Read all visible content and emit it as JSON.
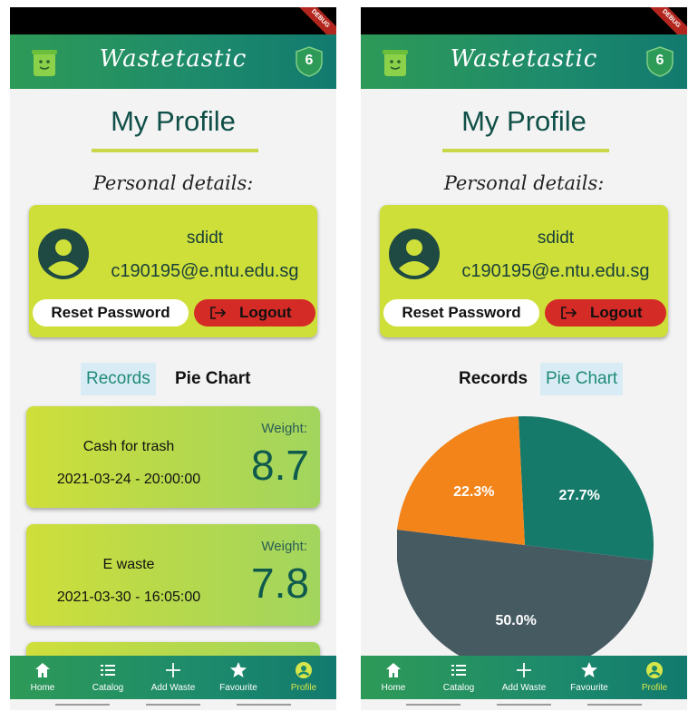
{
  "app": {
    "title": "Wastetastic",
    "badge_count": "6",
    "debug_banner": "DEBUG"
  },
  "profile": {
    "page_title": "My Profile",
    "section_title": "Personal details:",
    "username": "sdidt",
    "email": "c190195@e.ntu.edu.sg",
    "reset_label": "Reset Password",
    "logout_label": "Logout"
  },
  "tabs": {
    "records_label": "Records",
    "pie_label": "Pie Chart"
  },
  "records": [
    {
      "name": "Cash for trash",
      "date": "2021-03-24 - 20:00:00",
      "weight_label": "Weight:",
      "weight": "8.7"
    },
    {
      "name": "E waste",
      "date": "2021-03-30 - 16:05:00",
      "weight_label": "Weight:",
      "weight": "7.8"
    }
  ],
  "nav": [
    {
      "label": "Home",
      "icon": "home-icon"
    },
    {
      "label": "Catalog",
      "icon": "list-icon"
    },
    {
      "label": "Add Waste",
      "icon": "plus-icon"
    },
    {
      "label": "Favourite",
      "icon": "star-icon"
    },
    {
      "label": "Profile",
      "icon": "person-icon"
    }
  ],
  "colors": {
    "accent": "#d6e64a",
    "primary": "#1d8a6c",
    "logout": "#d42b27",
    "card": "#cfdf3a"
  },
  "chart_data": {
    "type": "pie",
    "slices": [
      {
        "label": "27.7%",
        "value": 27.7,
        "color": "#167a6b"
      },
      {
        "label": "50.0%",
        "value": 50.0,
        "color": "#465a62"
      },
      {
        "label": "22.3%",
        "value": 22.3,
        "color": "#f2841a"
      }
    ]
  }
}
